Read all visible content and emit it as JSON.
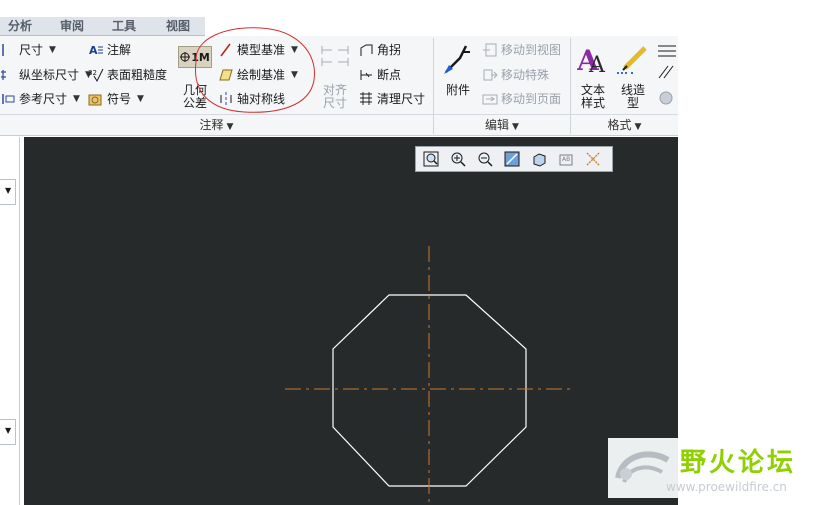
{
  "tabs": [
    "分析",
    "审阅",
    "工具",
    "视图"
  ],
  "annotate_group": {
    "col1": [
      {
        "label": "尺寸",
        "icon": "dimension-icon"
      },
      {
        "label": "纵坐标尺寸",
        "icon": "ordinate-dimension-icon"
      },
      {
        "label": "参考尺寸",
        "icon": "reference-dimension-icon"
      }
    ],
    "col2": [
      {
        "label": "注解",
        "icon": "note-icon"
      },
      {
        "label": "表面粗糙度",
        "icon": "surface-finish-icon"
      },
      {
        "label": "符号",
        "icon": "symbol-icon"
      }
    ],
    "gtol_label": "几何\n公差",
    "gtol_badge": "1M",
    "col3": [
      {
        "label": "模型基准",
        "icon": "model-datum-icon"
      },
      {
        "label": "绘制基准",
        "icon": "draft-datum-icon"
      },
      {
        "label": "轴对称线",
        "icon": "axis-symmetry-icon"
      }
    ],
    "align_label": "对齐\n尺寸",
    "col4": [
      {
        "label": "角拐",
        "icon": "jog-icon"
      },
      {
        "label": "断点",
        "icon": "breakpoint-icon"
      },
      {
        "label": "清理尺寸",
        "icon": "cleanup-dimensions-icon"
      }
    ],
    "footer": "注释"
  },
  "edit_group": {
    "attach_label": "附件",
    "items": [
      {
        "label": "移动到视图",
        "icon": "move-to-view-icon"
      },
      {
        "label": "移动特殊",
        "icon": "move-special-icon"
      },
      {
        "label": "移动到页面",
        "icon": "move-to-sheet-icon"
      }
    ],
    "footer": "编辑"
  },
  "format_group": {
    "text_style_label": "文本\n样式",
    "line_style_label": "线造\n型",
    "footer": "格式"
  },
  "view_toolbar": [
    "refit-icon",
    "zoom-in-icon",
    "zoom-out-icon",
    "repaint-icon",
    "display-style-icon",
    "annotation-display-icon",
    "datum-display-icon"
  ],
  "watermark": {
    "title": "野火论坛",
    "url": "www.proewildfire.cn"
  },
  "colors": {
    "canvas_bg": "#262a2b",
    "geometry": "#ffffff",
    "centerline": "#c8782a",
    "highlight_circle": "#d0302c",
    "watermark_text": "#8fd000"
  }
}
